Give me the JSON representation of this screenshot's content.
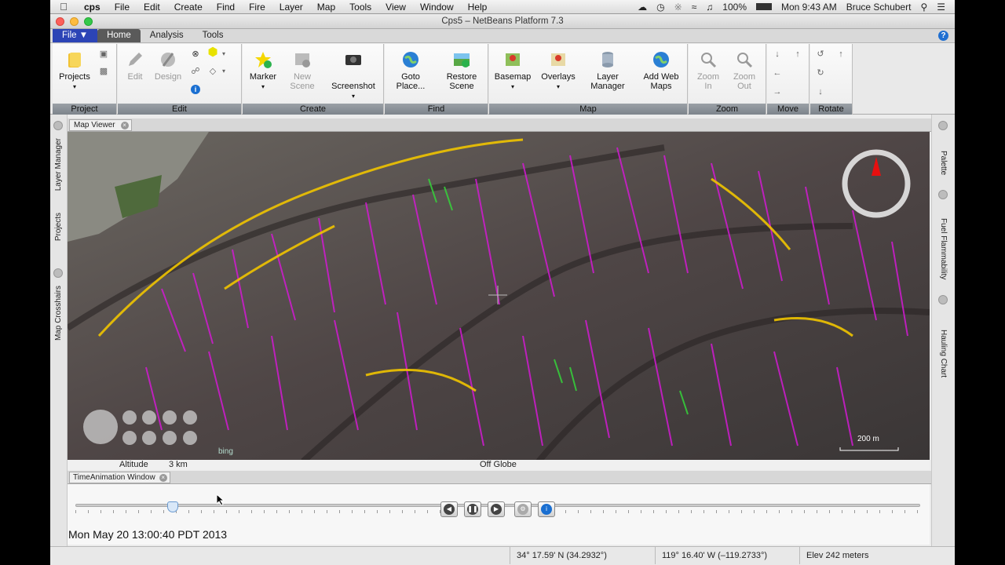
{
  "menubar": {
    "apple": "",
    "app": "cps",
    "items": [
      "File",
      "Edit",
      "Create",
      "Find",
      "Fire",
      "Layer",
      "Map",
      "Tools",
      "View",
      "Window",
      "Help"
    ],
    "battery": "100%",
    "clock": "Mon 9:43 AM",
    "user": "Bruce Schubert"
  },
  "window": {
    "title": "Cps5 – NetBeans Platform 7.3"
  },
  "ribbon_tabs": {
    "file": "File ▼",
    "home": "Home",
    "analysis": "Analysis",
    "tools": "Tools"
  },
  "ribbon": {
    "project": {
      "label": "Project",
      "projects": "Projects"
    },
    "edit": {
      "label": "Edit",
      "edit": "Edit",
      "design": "Design"
    },
    "create": {
      "label": "Create",
      "marker": "Marker",
      "new_scene_1": "New",
      "new_scene_2": "Scene",
      "screenshot": "Screenshot"
    },
    "find": {
      "label": "Find",
      "goto_1": "Goto",
      "goto_2": "Place...",
      "restore_1": "Restore",
      "restore_2": "Scene"
    },
    "map": {
      "label": "Map",
      "basemap": "Basemap",
      "overlays": "Overlays",
      "layer_mgr_1": "Layer",
      "layer_mgr_2": "Manager",
      "add_web_1": "Add Web",
      "add_web_2": "Maps"
    },
    "zoom": {
      "label": "Zoom",
      "zoom_in_1": "Zoom",
      "zoom_in_2": "In",
      "zoom_out_1": "Zoom",
      "zoom_out_2": "Out"
    },
    "move": {
      "label": "Move"
    },
    "rotate": {
      "label": "Rotate"
    }
  },
  "left_rail": {
    "layer_manager": "Layer Manager",
    "projects": "Projects",
    "map_crosshairs": "Map Crosshairs"
  },
  "right_rail": {
    "palette": "Palette",
    "fuel_flammability": "Fuel Flammability",
    "hauling_chart": "Hauling Chart"
  },
  "map_viewer": {
    "tab": "Map Viewer",
    "scale": "200 m",
    "bing": "bing"
  },
  "altitude_bar": {
    "label": "Altitude",
    "value": "3 km",
    "globe": "Off Globe"
  },
  "time_animation": {
    "tab": "TimeAnimation Window",
    "datetime": "Mon May 20 13:00:40 PDT 2013",
    "slider_fraction": 0.115
  },
  "status": {
    "lat": "34° 17.59' N  (34.2932°)",
    "lon": "119° 16.40' W  (–119.2733°)",
    "elev": "Elev 242 meters"
  }
}
